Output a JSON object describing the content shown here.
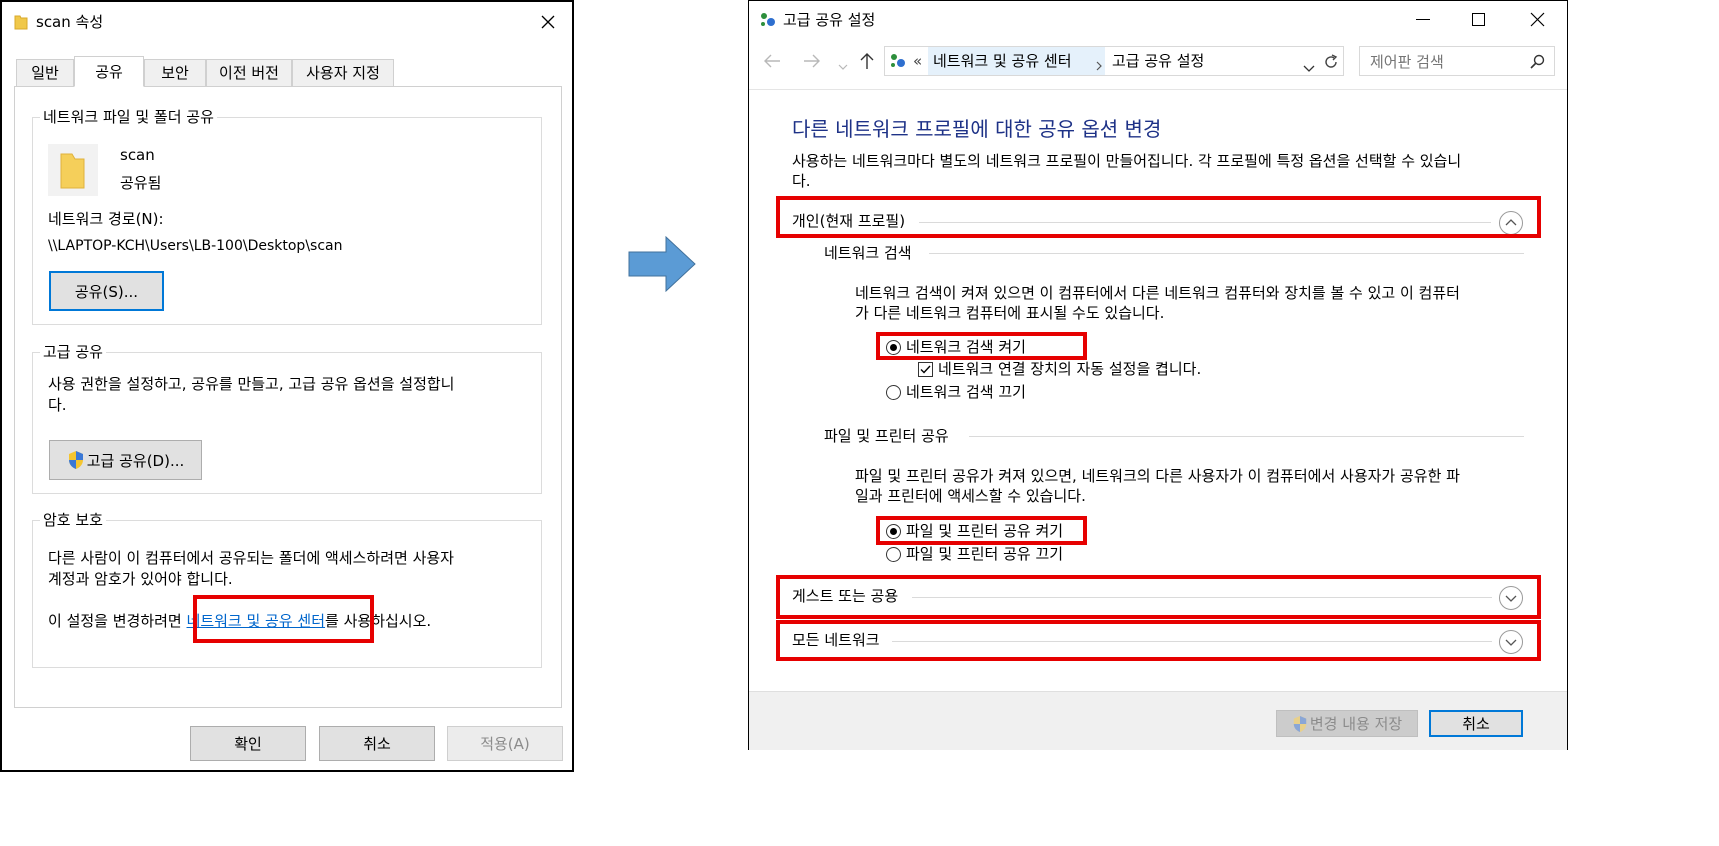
{
  "left": {
    "title": "scan 속성",
    "tabs": [
      "일반",
      "공유",
      "보안",
      "이전 버전",
      "사용자 지정"
    ],
    "net_share": {
      "heading": "네트워크 파일 및 폴더 공유",
      "folder_name": "scan",
      "folder_status": "공유됨",
      "path_label": "네트워크 경로(N):",
      "path_value": "\\\\LAPTOP-KCH\\Users\\LB-100\\Desktop\\scan",
      "share_button": "공유(S)..."
    },
    "adv_share": {
      "heading": "고급 공유",
      "desc_line1": "사용 권한을 설정하고, 공유를 만들고, 고급 공유 옵션을 설정합니",
      "desc_line2": "다.",
      "button": "고급 공유(D)..."
    },
    "password": {
      "heading": "암호 보호",
      "desc_line1": "다른 사람이 이 컴퓨터에서 공유되는 폴더에 액세스하려면 사용자",
      "desc_line2": "계정과 암호가 있어야 합니다.",
      "link_prefix": "이 설정을 변경하려면 ",
      "link_text": "네트워크 및 공유 센터",
      "link_suffix": "를 사용하십시오."
    },
    "buttons": {
      "ok": "확인",
      "cancel": "취소",
      "apply": "적용(A)"
    }
  },
  "right": {
    "title": "고급 공유 설정",
    "address": {
      "prefix": "«",
      "crumb1": "네트워크 및 공유 센터",
      "crumb2": "고급 공유 설정"
    },
    "search_placeholder": "제어판 검색",
    "heading": "다른 네트워크 프로필에 대한 공유 옵션 변경",
    "intro_line1": "사용하는 네트워크마다 별도의 네트워크 프로필이 만들어집니다. 각 프로필에 특정 옵션을 선택할 수 있습니",
    "intro_line2": "다.",
    "profile_private": "개인(현재 프로필)",
    "discovery": {
      "heading": "네트워크 검색",
      "desc_line1": "네트워크 검색이 켜져 있으면 이 컴퓨터에서 다른 네트워크 컴퓨터와 장치를 볼 수 있고 이 컴퓨터",
      "desc_line2": "가 다른 네트워크 컴퓨터에 표시될 수도 있습니다.",
      "opt_on": "네트워크 검색 켜기",
      "opt_auto": "네트워크 연결 장치의 자동 설정을 켭니다.",
      "opt_off": "네트워크 검색 끄기"
    },
    "file_share": {
      "heading": "파일 및 프린터 공유",
      "desc_line1": "파일 및 프린터 공유가 켜져 있으면, 네트워크의 다른 사용자가 이 컴퓨터에서 사용자가 공유한 파",
      "desc_line2": "일과 프린터에 액세스할 수 있습니다.",
      "opt_on": "파일 및 프린터 공유 켜기",
      "opt_off": "파일 및 프린터 공유 끄기"
    },
    "profile_guest": "게스트 또는 공용",
    "profile_all": "모든 네트워크",
    "buttons": {
      "save": "변경 내용 저장",
      "cancel": "취소"
    }
  },
  "colors": {
    "highlight": "#e60000",
    "link": "#0066cc",
    "arrow": "#5b9bd5",
    "heading_blue": "#1e3287"
  }
}
